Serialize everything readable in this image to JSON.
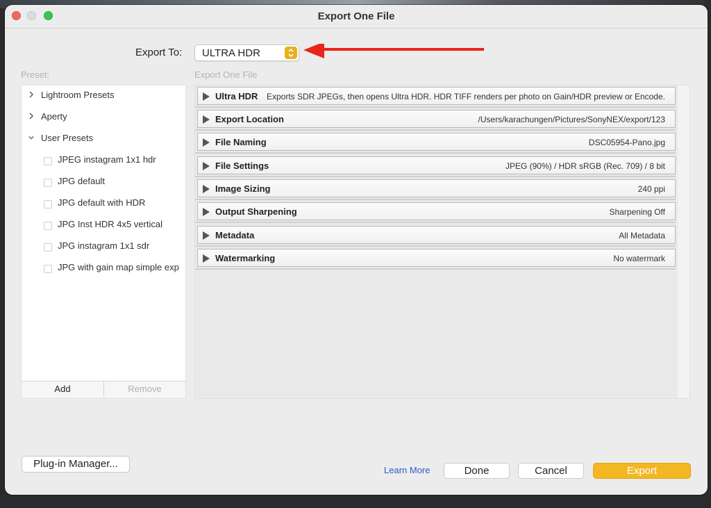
{
  "window": {
    "title": "Export One File"
  },
  "export_to": {
    "label": "Export To:",
    "value": "ULTRA HDR"
  },
  "preset": {
    "label": "Preset:",
    "groups": [
      {
        "label": "Lightroom Presets",
        "expanded": false
      },
      {
        "label": "Aperty",
        "expanded": false
      },
      {
        "label": "User Presets",
        "expanded": true
      }
    ],
    "user_presets": [
      "JPEG instagram 1x1 hdr",
      "JPG default",
      "JPG default with HDR",
      "JPG Inst HDR 4x5 vertical",
      "JPG instagram 1x1 sdr",
      "JPG with gain map simple exp"
    ],
    "add_label": "Add",
    "remove_label": "Remove"
  },
  "export_panel": {
    "label": "Export One File",
    "sections": [
      {
        "title": "Ultra HDR",
        "summary": "Exports SDR JPEGs, then opens Ultra HDR. HDR TIFF renders per photo on Gain/HDR preview or Encode."
      },
      {
        "title": "Export Location",
        "summary": "/Users/karachungen/Pictures/SonyNEX/export/123"
      },
      {
        "title": "File Naming",
        "summary": "DSC05954-Pano.jpg"
      },
      {
        "title": "File Settings",
        "summary": "JPEG (90%) / HDR sRGB (Rec. 709) / 8 bit"
      },
      {
        "title": "Image Sizing",
        "summary": "240 ppi"
      },
      {
        "title": "Output Sharpening",
        "summary": "Sharpening Off"
      },
      {
        "title": "Metadata",
        "summary": "All Metadata"
      },
      {
        "title": "Watermarking",
        "summary": "No watermark"
      }
    ]
  },
  "footer": {
    "plugin_manager": "Plug-in Manager...",
    "learn_more": "Learn More",
    "done": "Done",
    "cancel": "Cancel",
    "export": "Export"
  },
  "colors": {
    "accent": "#f2b722",
    "annotation_arrow": "#e8261b",
    "link": "#2a5bc4"
  },
  "icons": [
    "close-icon",
    "minimize-icon",
    "zoom-icon",
    "chevron-right-icon",
    "chevron-down-icon",
    "stepper-icon",
    "disclosure-triangle-icon",
    "red-arrow-icon"
  ]
}
